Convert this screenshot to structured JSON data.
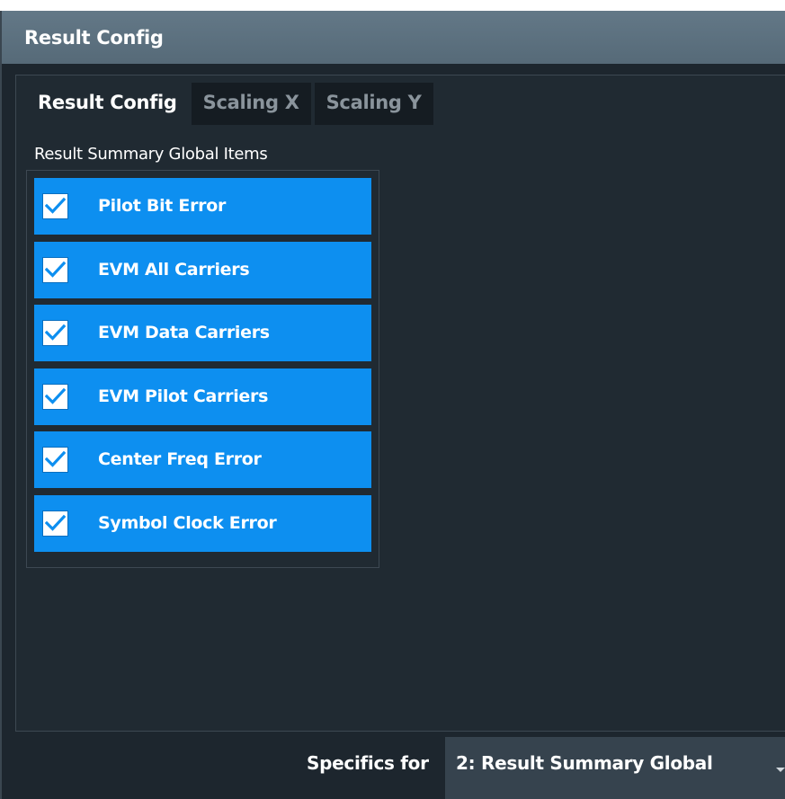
{
  "window": {
    "title": "Result Config"
  },
  "tabs": [
    {
      "label": "Result Config",
      "active": true
    },
    {
      "label": "Scaling X",
      "active": false
    },
    {
      "label": "Scaling Y",
      "active": false
    }
  ],
  "group": {
    "label": "Result Summary Global Items",
    "items": [
      {
        "label": "Pilot Bit Error",
        "checked": true
      },
      {
        "label": "EVM All Carriers",
        "checked": true
      },
      {
        "label": "EVM Data Carriers",
        "checked": true
      },
      {
        "label": "EVM Pilot Carriers",
        "checked": true
      },
      {
        "label": "Center Freq Error",
        "checked": true
      },
      {
        "label": "Symbol Clock Error",
        "checked": true
      }
    ]
  },
  "footer": {
    "specifics_label": "Specifics for",
    "selected": "2: Result Summary Global"
  },
  "colors": {
    "accent": "#0d8ff0",
    "title_bar": "#5d7281",
    "panel_bg": "#202a32"
  }
}
